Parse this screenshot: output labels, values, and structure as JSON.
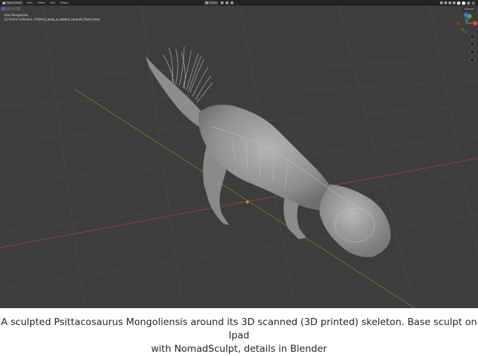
{
  "header": {
    "mode_label": "Object Mode",
    "menus": [
      "View",
      "Select",
      "Add",
      "Object"
    ],
    "transform_orientation": "Global",
    "options_label": "Options"
  },
  "viewport": {
    "view_name": "User Perspective",
    "collection_info": "(1) Scene Collection | Psittaco_body_w_tabbed_normals_fixed_mesh"
  },
  "gizmo": {
    "axes": [
      "x-axis-icon",
      "y-axis-icon",
      "z-axis-icon"
    ],
    "colors": {
      "x": "#e04a4f",
      "y": "#6ea22a",
      "z": "#3a7ad6"
    }
  },
  "nav_tools": [
    "zoom-icon",
    "hand-pan-icon",
    "camera-icon",
    "grid-icon"
  ],
  "colors": {
    "viewport_bg": "#3d3d3d",
    "header_bg": "#232323",
    "x_axis_line": "#9b3c40",
    "y_axis_line": "#6a7a2a",
    "model": "#9a9a9a"
  },
  "caption": {
    "line1": "A sculpted Psittacosaurus Mongoliensis around its 3D scanned (3D printed) skeleton. Base sculpt on Ipad",
    "line2": "with NomadSculpt, details in Blender"
  }
}
